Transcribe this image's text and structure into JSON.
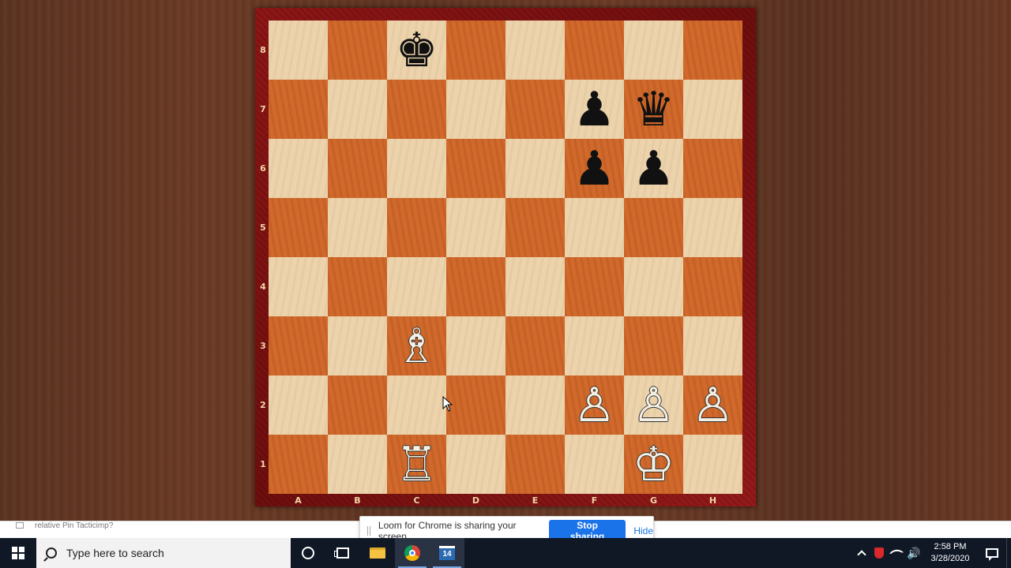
{
  "board": {
    "ranks": [
      "8",
      "7",
      "6",
      "5",
      "4",
      "3",
      "2",
      "1"
    ],
    "files": [
      "A",
      "B",
      "C",
      "D",
      "E",
      "F",
      "G",
      "H"
    ],
    "squares": [
      [
        "",
        "",
        "♚",
        "",
        "",
        "",
        "",
        ""
      ],
      [
        "",
        "",
        "",
        "",
        "",
        "♟",
        "♛",
        ""
      ],
      [
        "",
        "",
        "",
        "",
        "",
        "♟",
        "♟",
        ""
      ],
      [
        "",
        "",
        "",
        "",
        "",
        "",
        "",
        ""
      ],
      [
        "",
        "",
        "",
        "",
        "",
        "",
        "",
        ""
      ],
      [
        "",
        "",
        "♗",
        "",
        "",
        "",
        "",
        ""
      ],
      [
        "",
        "",
        "",
        "",
        "",
        "♙",
        "♙",
        "♙"
      ],
      [
        "",
        "",
        "♖",
        "",
        "",
        "",
        "♔",
        ""
      ]
    ],
    "piece_names": {
      "♚": {
        "name": "black-king",
        "color": "black"
      },
      "♛": {
        "name": "black-queen",
        "color": "black"
      },
      "♟": {
        "name": "black-pawn",
        "color": "black"
      },
      "♔": {
        "name": "white-king",
        "color": "white"
      },
      "♗": {
        "name": "white-bishop",
        "color": "white"
      },
      "♖": {
        "name": "white-rook",
        "color": "white"
      },
      "♙": {
        "name": "white-pawn",
        "color": "white"
      }
    },
    "colors": {
      "light": "#ecd3ac",
      "dark": "#d0692b",
      "frame": "#8e1616"
    }
  },
  "share_bar": {
    "message": "Loom for Chrome is sharing your screen.",
    "stop_label": "Stop sharing",
    "hide_label": "Hide"
  },
  "taskbar": {
    "search_placeholder": "Type here to search",
    "calendar_day": "14",
    "clock_time": "2:58 PM",
    "clock_date": "3/28/2020"
  },
  "browser_strip": {
    "tab_text": "relative Pin Tacticimp?"
  }
}
